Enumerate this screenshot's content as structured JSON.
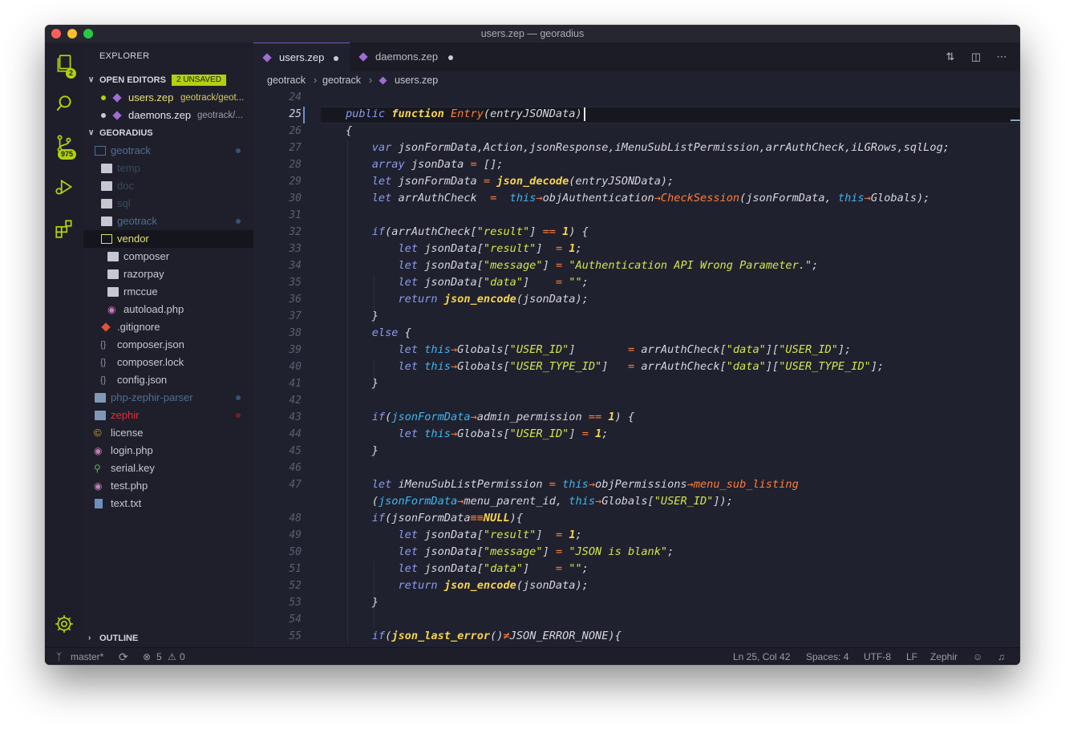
{
  "window": {
    "title": "users.zep — georadius"
  },
  "activity": {
    "explorer_badge": "2",
    "scm_badge": "975"
  },
  "sidebar": {
    "title": "EXPLORER",
    "open_editors": {
      "header": "OPEN EDITORS",
      "unsaved_badge": "2 UNSAVED",
      "items": [
        {
          "name": "users.zep",
          "path": "geotrack/geot..."
        },
        {
          "name": "daemons.zep",
          "path": "geotrack/..."
        }
      ]
    },
    "workspace": {
      "header": "GEORADIUS",
      "tree": [
        {
          "label": "geotrack"
        },
        {
          "label": "temp"
        },
        {
          "label": "doc"
        },
        {
          "label": "sql"
        },
        {
          "label": "geotrack"
        },
        {
          "label": "vendor"
        },
        {
          "label": "composer"
        },
        {
          "label": "razorpay"
        },
        {
          "label": "rmccue"
        },
        {
          "label": "autoload.php"
        },
        {
          "label": ".gitignore"
        },
        {
          "label": "composer.json"
        },
        {
          "label": "composer.lock"
        },
        {
          "label": "config.json"
        },
        {
          "label": "php-zephir-parser"
        },
        {
          "label": "zephir"
        },
        {
          "label": "license"
        },
        {
          "label": "login.php"
        },
        {
          "label": "serial.key"
        },
        {
          "label": "test.php"
        },
        {
          "label": "text.txt"
        }
      ]
    },
    "outline": "OUTLINE"
  },
  "tabs": [
    {
      "label": "users.zep"
    },
    {
      "label": "daemons.zep"
    }
  ],
  "breadcrumbs": [
    "geotrack",
    "geotrack",
    "users.zep"
  ],
  "editor": {
    "line_numbers": [
      "24",
      "25",
      "26",
      "27",
      "28",
      "29",
      "30",
      "31",
      "32",
      "33",
      "34",
      "35",
      "36",
      "37",
      "38",
      "39",
      "40",
      "41",
      "42",
      "43",
      "44",
      "45",
      "46",
      "47",
      "",
      "48",
      "49",
      "50",
      "51",
      "52",
      "53",
      "54",
      "55"
    ],
    "current_line": "25"
  },
  "status": {
    "branch": "master*",
    "problems_errors": "5",
    "problems_warnings": "0",
    "position": "Ln 25, Col 42",
    "spaces": "Spaces: 4",
    "encoding": "UTF-8",
    "eol": "LF",
    "language": "Zephir"
  },
  "colors": {
    "accent": "#b3d10b",
    "keyword": "#8a9cf0",
    "function": "#f7d54b",
    "string": "#d3e64a",
    "operator": "#ff7e3a",
    "this": "#3fb6f0"
  }
}
